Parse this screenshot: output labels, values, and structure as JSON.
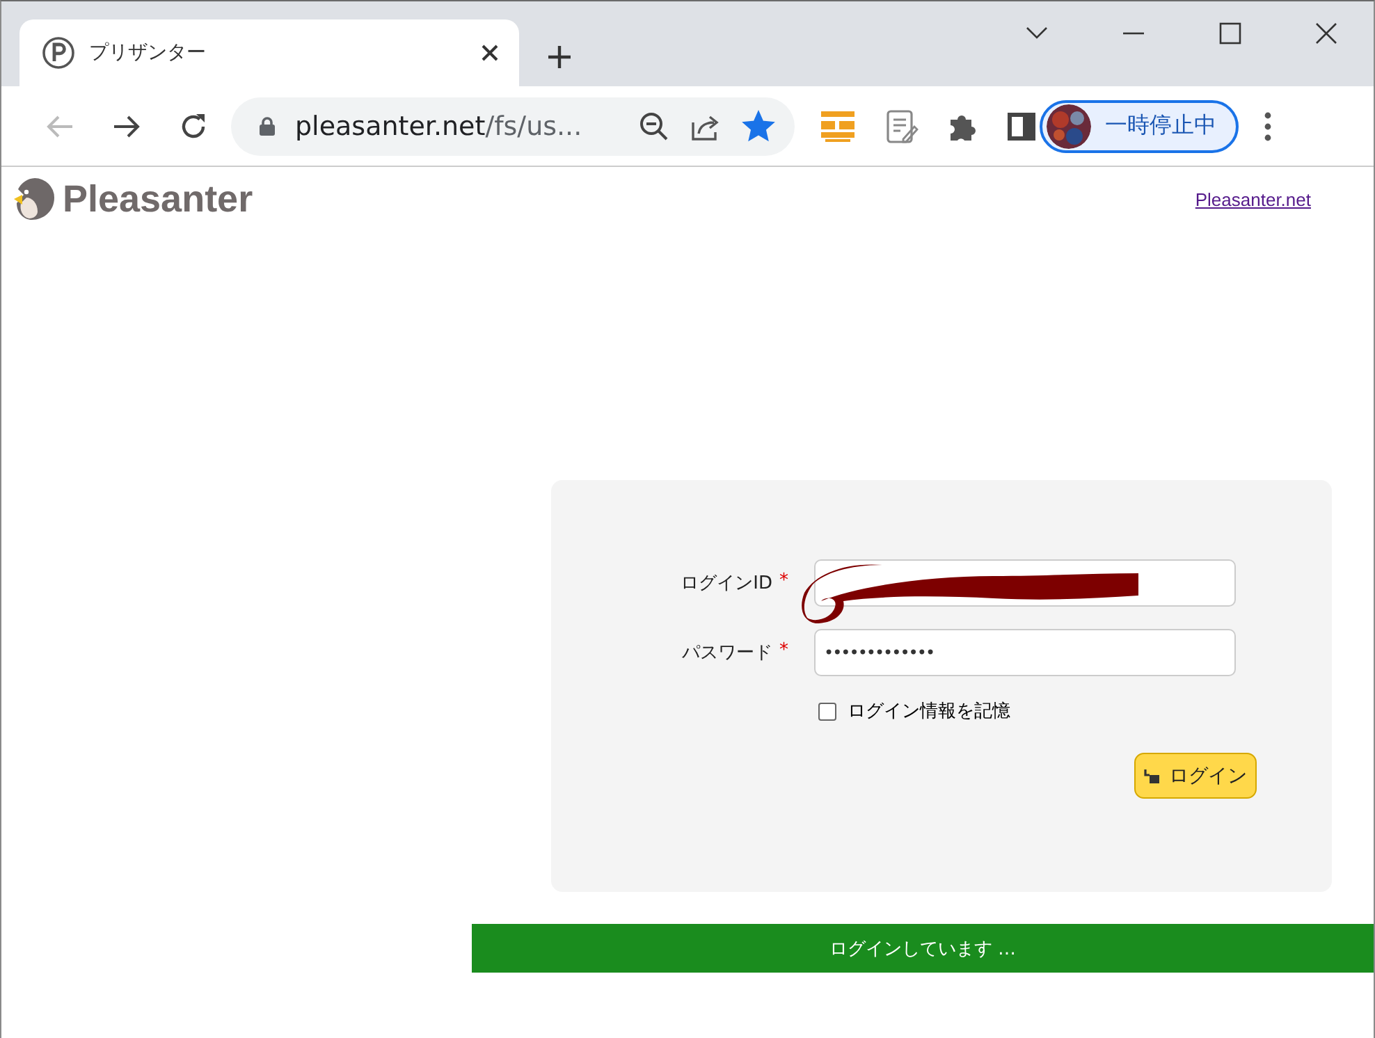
{
  "tabs": [
    {
      "title": "プリザンター",
      "selected": true
    }
  ],
  "toolbar": {
    "url_host": "pleasanter.net",
    "url_path": "/fs/us...",
    "bookmarked": true,
    "profile_label": "一時停止中"
  },
  "header": {
    "logo_text": "Pleasanter",
    "link": "Pleasanter.net"
  },
  "form": {
    "fields": [
      {
        "kind": "redacted",
        "label": "ログインID",
        "required_mark": "*"
      },
      {
        "kind": "password",
        "label": "パスワード",
        "required_mark": "*",
        "value": "•••••••••••••"
      }
    ],
    "remember": {
      "label": "ログイン情報を記憶",
      "checked": false
    },
    "button": "ログイン"
  },
  "status_message": "ログインしています …"
}
